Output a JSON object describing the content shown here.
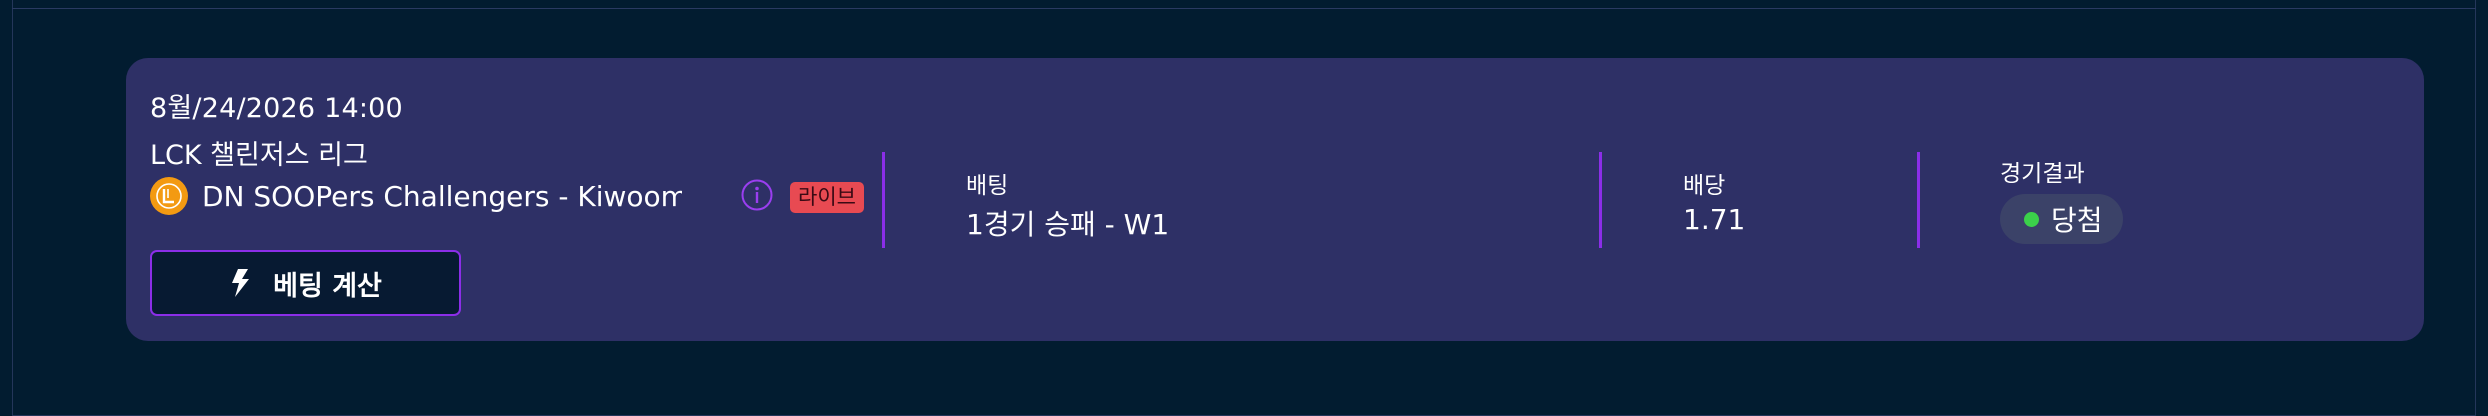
{
  "colors": {
    "background": "#021c30",
    "card": "#2e3066",
    "accent": "#8b2ee8",
    "live_badge": "#e84a52",
    "win_dot": "#3bd14a",
    "league_logo": "#f39a12"
  },
  "bet": {
    "date": "8월/24/2026 14:00",
    "league": "LCK 챌린저스 리그",
    "league_logo_icon": "lck-cl-logo-icon",
    "teams": "DN SOOPers Challengers - Kiwoom D...",
    "info_icon": "info-icon",
    "live_label": "라이브",
    "calc_button_label": "베팅 계산",
    "calc_icon": "lightning-icon"
  },
  "details": {
    "bet_label": "배팅",
    "bet_value": "1경기 승패 - W1",
    "odds_label": "배당",
    "odds_value": "1.71",
    "result_label": "경기결과",
    "result_value": "당첨"
  }
}
